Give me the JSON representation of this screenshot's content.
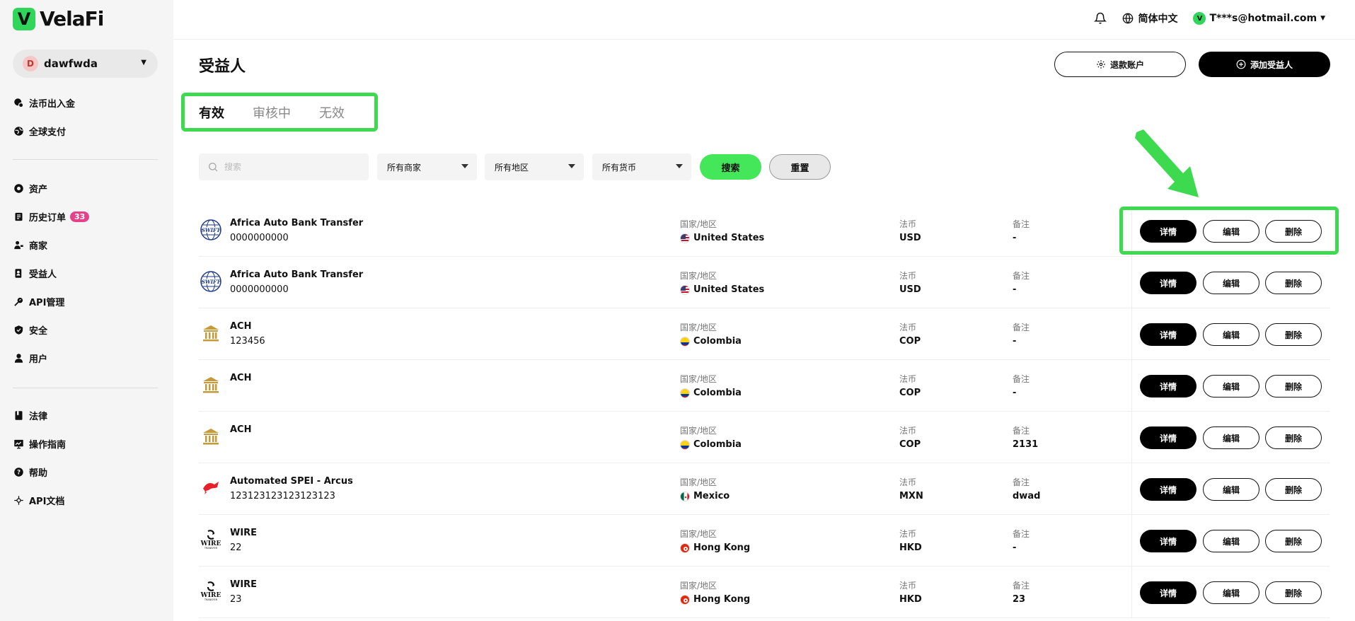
{
  "brand": {
    "name": "VelaFi",
    "mark": "V"
  },
  "account": {
    "avatar": "D",
    "name": "dawfwda"
  },
  "nav": {
    "group1": [
      {
        "label": "法币出入金",
        "icon": "fiat-icon"
      },
      {
        "label": "全球支付",
        "icon": "globe-payment-icon"
      }
    ],
    "group2": [
      {
        "label": "资产",
        "icon": "assets-icon"
      },
      {
        "label": "历史订单",
        "icon": "orders-icon",
        "badge": "33"
      },
      {
        "label": "商家",
        "icon": "merchant-icon"
      },
      {
        "label": "受益人",
        "icon": "beneficiary-icon"
      },
      {
        "label": "API管理",
        "icon": "api-key-icon"
      },
      {
        "label": "安全",
        "icon": "shield-icon"
      },
      {
        "label": "用户",
        "icon": "user-icon"
      }
    ],
    "group3": [
      {
        "label": "法律",
        "icon": "book-icon"
      },
      {
        "label": "操作指南",
        "icon": "guide-icon"
      },
      {
        "label": "帮助",
        "icon": "help-icon"
      },
      {
        "label": "API文档",
        "icon": "api-doc-icon"
      }
    ]
  },
  "header": {
    "language": "简体中文",
    "user_initial": "V",
    "user_email": "T***s@hotmail.com"
  },
  "page": {
    "title": "受益人",
    "refund_button": "退款账户",
    "add_button": "添加受益人",
    "tabs": [
      "有效",
      "审核中",
      "无效"
    ],
    "search_placeholder": "搜索",
    "filters": [
      "所有商家",
      "所有地区",
      "所有货币"
    ],
    "search_button": "搜索",
    "reset_button": "重置"
  },
  "columns": {
    "region": "国家/地区",
    "currency": "法币",
    "note": "备注"
  },
  "actions": {
    "detail": "详情",
    "edit": "编辑",
    "delete": "删除"
  },
  "rows": [
    {
      "logo": "swift",
      "name": "Africa Auto Bank Transfer",
      "account": "0000000000",
      "region": "United States",
      "flag": "us",
      "currency": "USD",
      "note": "-"
    },
    {
      "logo": "swift",
      "name": "Africa Auto Bank Transfer",
      "account": "0000000000",
      "region": "United States",
      "flag": "us",
      "currency": "USD",
      "note": "-"
    },
    {
      "logo": "bank",
      "name": "ACH",
      "account": "123456",
      "region": "Colombia",
      "flag": "co",
      "currency": "COP",
      "note": "-"
    },
    {
      "logo": "bank",
      "name": "ACH",
      "account": "",
      "region": "Colombia",
      "flag": "co",
      "currency": "COP",
      "note": "-"
    },
    {
      "logo": "bank",
      "name": "ACH",
      "account": "",
      "region": "Colombia",
      "flag": "co",
      "currency": "COP",
      "note": "2131"
    },
    {
      "logo": "arcus",
      "name": "Automated SPEI - Arcus",
      "account": "123123123123123123",
      "region": "Mexico",
      "flag": "mx",
      "currency": "MXN",
      "note": "dwad"
    },
    {
      "logo": "wire",
      "name": "WIRE",
      "account": "22",
      "region": "Hong Kong",
      "flag": "hk",
      "currency": "HKD",
      "note": "-"
    },
    {
      "logo": "wire",
      "name": "WIRE",
      "account": "23",
      "region": "Hong Kong",
      "flag": "hk",
      "currency": "HKD",
      "note": "23"
    }
  ]
}
